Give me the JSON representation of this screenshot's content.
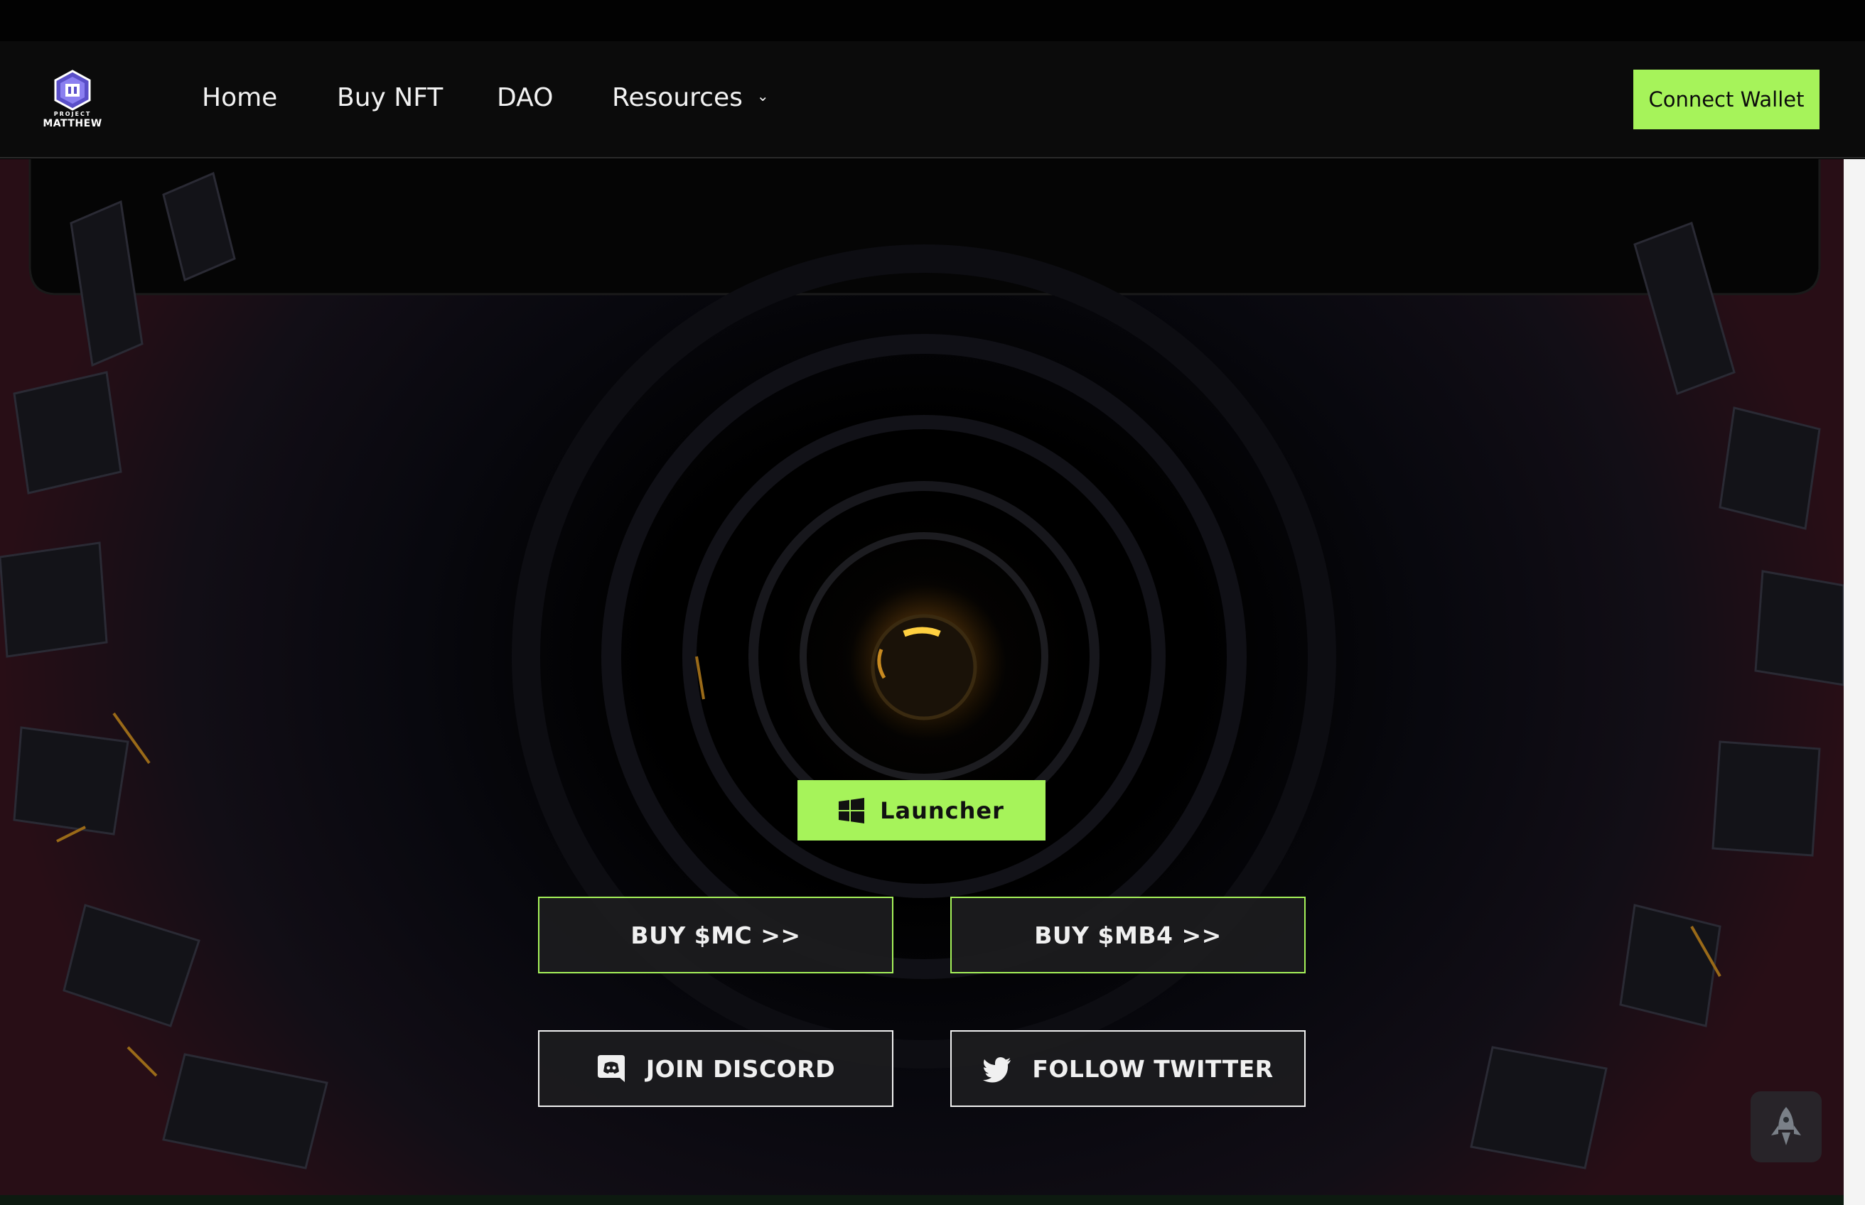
{
  "navbar": {
    "logo_line1": "PROJECT",
    "logo_line2": "MATTHEW",
    "links": [
      "Home",
      "Buy NFT",
      "DAO",
      "Resources"
    ],
    "resources_icon": "chevron-down-icon",
    "connect_wallet": "Connect Wallet"
  },
  "hero": {
    "launcher_label": "Launcher",
    "launcher_icon": "windows-icon",
    "buy_mc": "BUY $MC >>",
    "buy_mb4": "BUY $MB4 >>",
    "join_discord": "JOIN DISCORD",
    "discord_icon": "discord-icon",
    "follow_twitter": "FOLLOW TWITTER",
    "twitter_icon": "twitter-icon",
    "scroll_top_icon": "rocket-icon"
  },
  "colors": {
    "accent": "#a6f35a",
    "nav_bg": "#0b0b0b",
    "button_bg": "#1c1c1e",
    "text": "#f2f2f2"
  }
}
